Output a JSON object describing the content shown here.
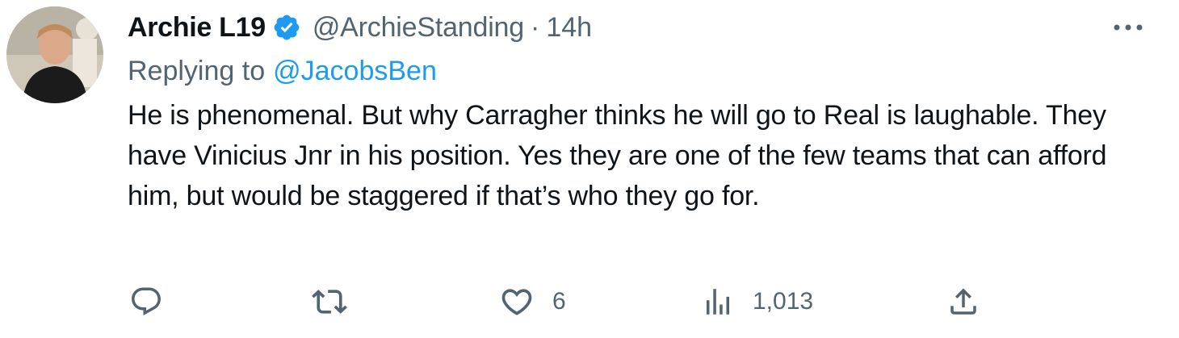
{
  "tweet": {
    "author": {
      "display_name": "Archie L19",
      "handle": "@ArchieStanding",
      "verified": true
    },
    "separator": "·",
    "timestamp": "14h",
    "replying_to": {
      "label": "Replying to",
      "handle": "@JacobsBen"
    },
    "text": "He is phenomenal. But why Carragher thinks he will go to Real is laughable. They have Vinicius Jnr in his position. Yes they are one of the few teams that can afford him, but would be staggered if that’s who they go for."
  },
  "actions": {
    "reply": {
      "icon": "reply-icon",
      "count": ""
    },
    "retweet": {
      "icon": "retweet-icon",
      "count": ""
    },
    "like": {
      "icon": "heart-icon",
      "count": "6"
    },
    "views": {
      "icon": "analytics-icon",
      "count": "1,013"
    },
    "share": {
      "icon": "share-icon",
      "count": ""
    }
  },
  "colors": {
    "text": "#0f1419",
    "secondary": "#536471",
    "link": "#1d9bf0",
    "verified": "#1d9bf0"
  }
}
